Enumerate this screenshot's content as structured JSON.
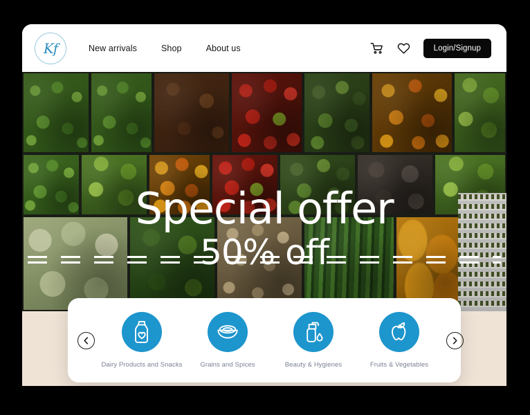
{
  "brand": {
    "monogram": "Kf",
    "logo_icon": "circle-monogram-logo"
  },
  "nav": {
    "items": [
      {
        "label": "New arrivals",
        "name": "nav-new-arrivals"
      },
      {
        "label": "Shop",
        "name": "nav-shop"
      },
      {
        "label": "About us",
        "name": "nav-about-us"
      }
    ]
  },
  "header_actions": {
    "cart_icon": "shopping-cart-icon",
    "wishlist_icon": "heart-icon",
    "login_label": "Login/Signup"
  },
  "hero": {
    "title": "Special offer",
    "subtitle": "50% off",
    "background": "grocery-produce-shelves-photo"
  },
  "carousel": {
    "prev_icon": "chevron-left-icon",
    "next_icon": "chevron-right-icon",
    "categories": [
      {
        "label": "Dairy Products and Snacks",
        "icon": "milk-bottle-heart-icon"
      },
      {
        "label": "Grains and Spices",
        "icon": "rice-bowl-icon"
      },
      {
        "label": "Beauty & Hygienes",
        "icon": "soap-dispenser-droplet-icon"
      },
      {
        "label": "Fruits & Vegetables",
        "icon": "apple-icon"
      }
    ]
  },
  "colors": {
    "accent_blue": "#1D95CD",
    "logo_blue": "#2F8FC0",
    "beige_background": "#EFE3D6",
    "button_black": "#090909",
    "label_gray": "#7B8193"
  }
}
